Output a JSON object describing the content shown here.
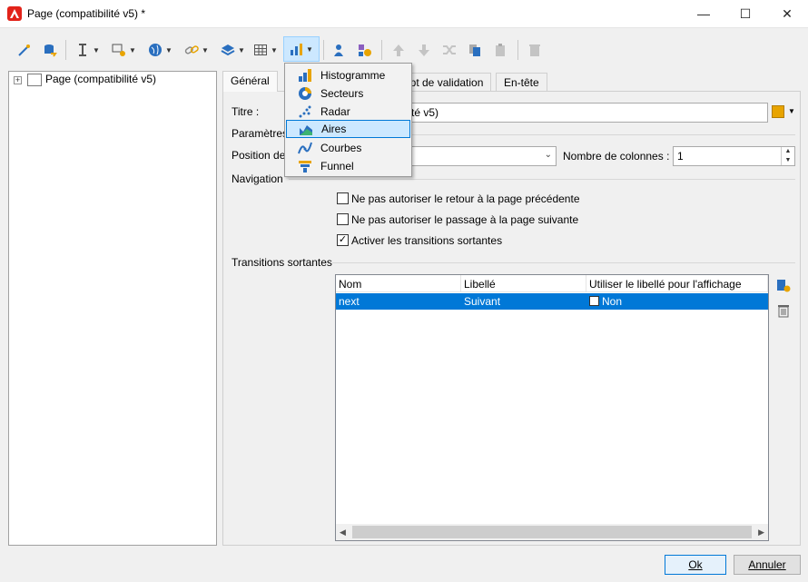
{
  "window": {
    "title": "Page (compatibilité v5) *",
    "minimize": "—",
    "maximize": "☐",
    "close": "✕"
  },
  "tree": {
    "root_label": "Page (compatibilité v5)",
    "expander": "+"
  },
  "tabs": [
    {
      "label": "Général"
    },
    {
      "label": "ipt de validation"
    },
    {
      "label": "En-tête"
    }
  ],
  "form": {
    "title_label": "Titre :",
    "title_value": "ilité v5)",
    "params_label": "Paramètres",
    "position_label": "Position de",
    "columns_label": "Nombre de colonnes :",
    "columns_value": "1",
    "navigation_label": "Navigation",
    "checks": [
      {
        "label": "Ne pas autoriser le retour à la page précédente",
        "checked": false
      },
      {
        "label": "Ne pas autoriser le passage à la page suivante",
        "checked": false
      },
      {
        "label": "Activer les transitions sortantes",
        "checked": true
      }
    ],
    "transitions_label": "Transitions sortantes"
  },
  "grid": {
    "columns": [
      "Nom",
      "Libellé",
      "Utiliser le libellé pour l'affichage"
    ],
    "rows": [
      {
        "name": "next",
        "label": "Suivant",
        "use_label": "Non"
      }
    ]
  },
  "menu": {
    "items": [
      {
        "label": "Histogramme",
        "icon": "histogram-icon"
      },
      {
        "label": "Secteurs",
        "icon": "pie-icon"
      },
      {
        "label": "Radar",
        "icon": "radar-icon"
      },
      {
        "label": "Aires",
        "icon": "area-icon",
        "highlighted": true
      },
      {
        "label": "Courbes",
        "icon": "curves-icon"
      },
      {
        "label": "Funnel",
        "icon": "funnel-icon"
      }
    ]
  },
  "buttons": {
    "ok": "Ok",
    "cancel": "Annuler"
  },
  "colors": {
    "accent": "#0078d7",
    "brand": "#e2231a",
    "highlight": "#cce8ff"
  }
}
